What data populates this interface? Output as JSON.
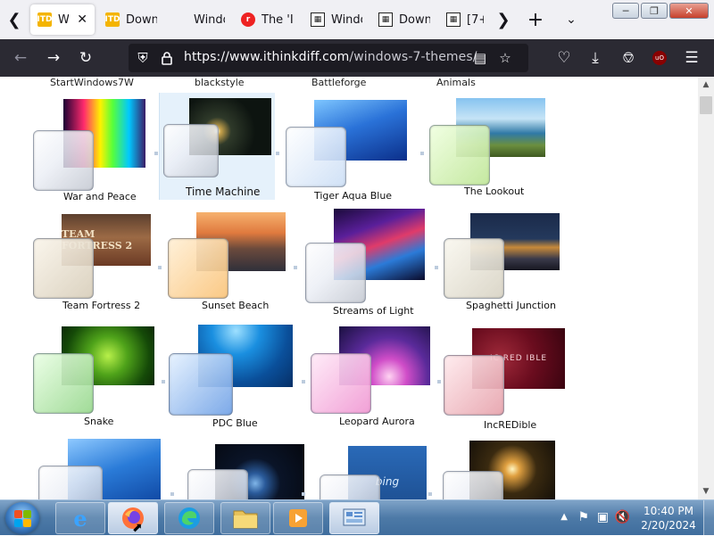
{
  "browser": {
    "tabs": [
      {
        "title": "Wi",
        "favicon": "itd-icon",
        "active": true
      },
      {
        "title": "Down",
        "favicon": "itd-icon"
      },
      {
        "title": "Windo",
        "favicon": "windows-icon"
      },
      {
        "title": "The 'I",
        "favicon": "red-circle-icon"
      },
      {
        "title": "Windo",
        "favicon": "document-icon"
      },
      {
        "title": "Down",
        "favicon": "document-icon"
      },
      {
        "title": "[7+] \\",
        "favicon": "document-icon"
      }
    ],
    "url": {
      "host": "https://www.ithinkdiff.com",
      "path": "/windows-7-themes/"
    }
  },
  "top_labels": [
    "StartWindows7W",
    "blackstyle",
    "Battleforge",
    "Animals"
  ],
  "themes": [
    {
      "label": "War and Peace"
    },
    {
      "label": "Time Machine",
      "selected": true
    },
    {
      "label": "Tiger Aqua Blue"
    },
    {
      "label": "The Lookout"
    },
    {
      "label": "Team Fortress 2",
      "wallpaper_text": "TEAM FORTRESS 2"
    },
    {
      "label": "Sunset Beach"
    },
    {
      "label": "Streams of Light"
    },
    {
      "label": "Spaghetti Junction"
    },
    {
      "label": "Snake"
    },
    {
      "label": "PDC Blue"
    },
    {
      "label": "Leopard Aurora"
    },
    {
      "label": "IncREDible",
      "wallpaper_text": "IC RED IBLE"
    },
    {
      "label": ""
    },
    {
      "label": ""
    },
    {
      "label": "",
      "wallpaper_text": "bing"
    },
    {
      "label": ""
    }
  ],
  "taskbar": {
    "clock_time": "10:40 PM",
    "clock_date": "2/20/2024"
  },
  "colors": {
    "tab_strip": "#f0f0f4",
    "navbar": "#2b2a33",
    "urlbar": "#1c1b22",
    "taskbar": "#4d7aa7",
    "selection": "#e5f1fb"
  }
}
